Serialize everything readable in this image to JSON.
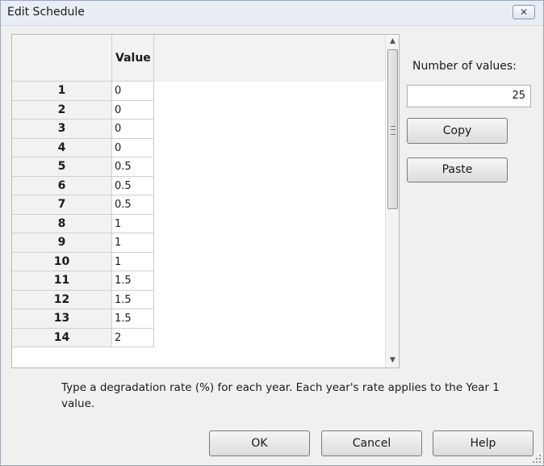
{
  "window": {
    "title": "Edit Schedule"
  },
  "grid": {
    "column_header": "Value",
    "rows": [
      {
        "label": "1",
        "value": "0"
      },
      {
        "label": "2",
        "value": "0"
      },
      {
        "label": "3",
        "value": "0"
      },
      {
        "label": "4",
        "value": "0"
      },
      {
        "label": "5",
        "value": "0.5"
      },
      {
        "label": "6",
        "value": "0.5"
      },
      {
        "label": "7",
        "value": "0.5"
      },
      {
        "label": "8",
        "value": "1"
      },
      {
        "label": "9",
        "value": "1"
      },
      {
        "label": "10",
        "value": "1"
      },
      {
        "label": "11",
        "value": "1.5"
      },
      {
        "label": "12",
        "value": "1.5"
      },
      {
        "label": "13",
        "value": "1.5"
      },
      {
        "label": "14",
        "value": "2"
      }
    ]
  },
  "side": {
    "number_label": "Number of values:",
    "number_value": "25",
    "copy_label": "Copy",
    "paste_label": "Paste"
  },
  "description": "Type a degradation rate (%) for each year. Each year's rate applies to the Year 1 value.",
  "footer": {
    "ok_label": "OK",
    "cancel_label": "Cancel",
    "help_label": "Help"
  },
  "icons": {
    "close": "close-icon",
    "scroll_up": "scroll-up-arrow-icon",
    "scroll_down": "scroll-down-arrow-icon",
    "resize": "resize-grip-icon"
  }
}
